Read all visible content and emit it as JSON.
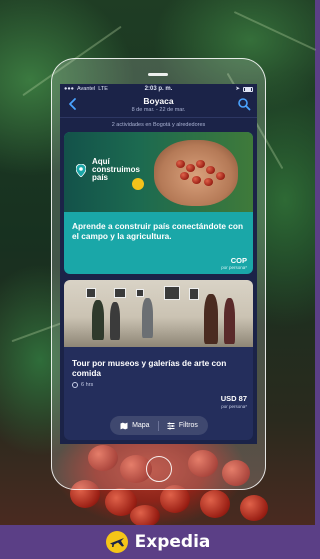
{
  "status_bar": {
    "carrier": "Avantel",
    "network": "LTE",
    "time": "2:03 p. m."
  },
  "header": {
    "title": "Boyaca",
    "dates": "8 de mar. - 22 de mar."
  },
  "results": {
    "count_text": "2 actividades en Bogotá y alrededores"
  },
  "cards": [
    {
      "image_logo": "Aquí construimos país",
      "title": "Aprende a construir país conectándote con el campo y la agricultura.",
      "price": "COP",
      "price_note": "por persona*"
    },
    {
      "title": "Tour por museos y galerías de arte con comida",
      "duration": "6 hrs",
      "price": "USD 87",
      "price_note": "por persona*"
    }
  ],
  "bottom_actions": {
    "map_label": "Mapa",
    "filters_label": "Filtros"
  },
  "brand": {
    "name": "Expedia"
  },
  "colors": {
    "screen_bg": "#1b2348",
    "card_teal": "#1aa7a8",
    "brand_purple": "#5b3f86",
    "accent_blue": "#4aa3ff"
  },
  "icons": [
    "back-arrow-icon",
    "search-icon",
    "clock-icon",
    "map-icon",
    "filters-icon",
    "expedia-plane-icon"
  ]
}
